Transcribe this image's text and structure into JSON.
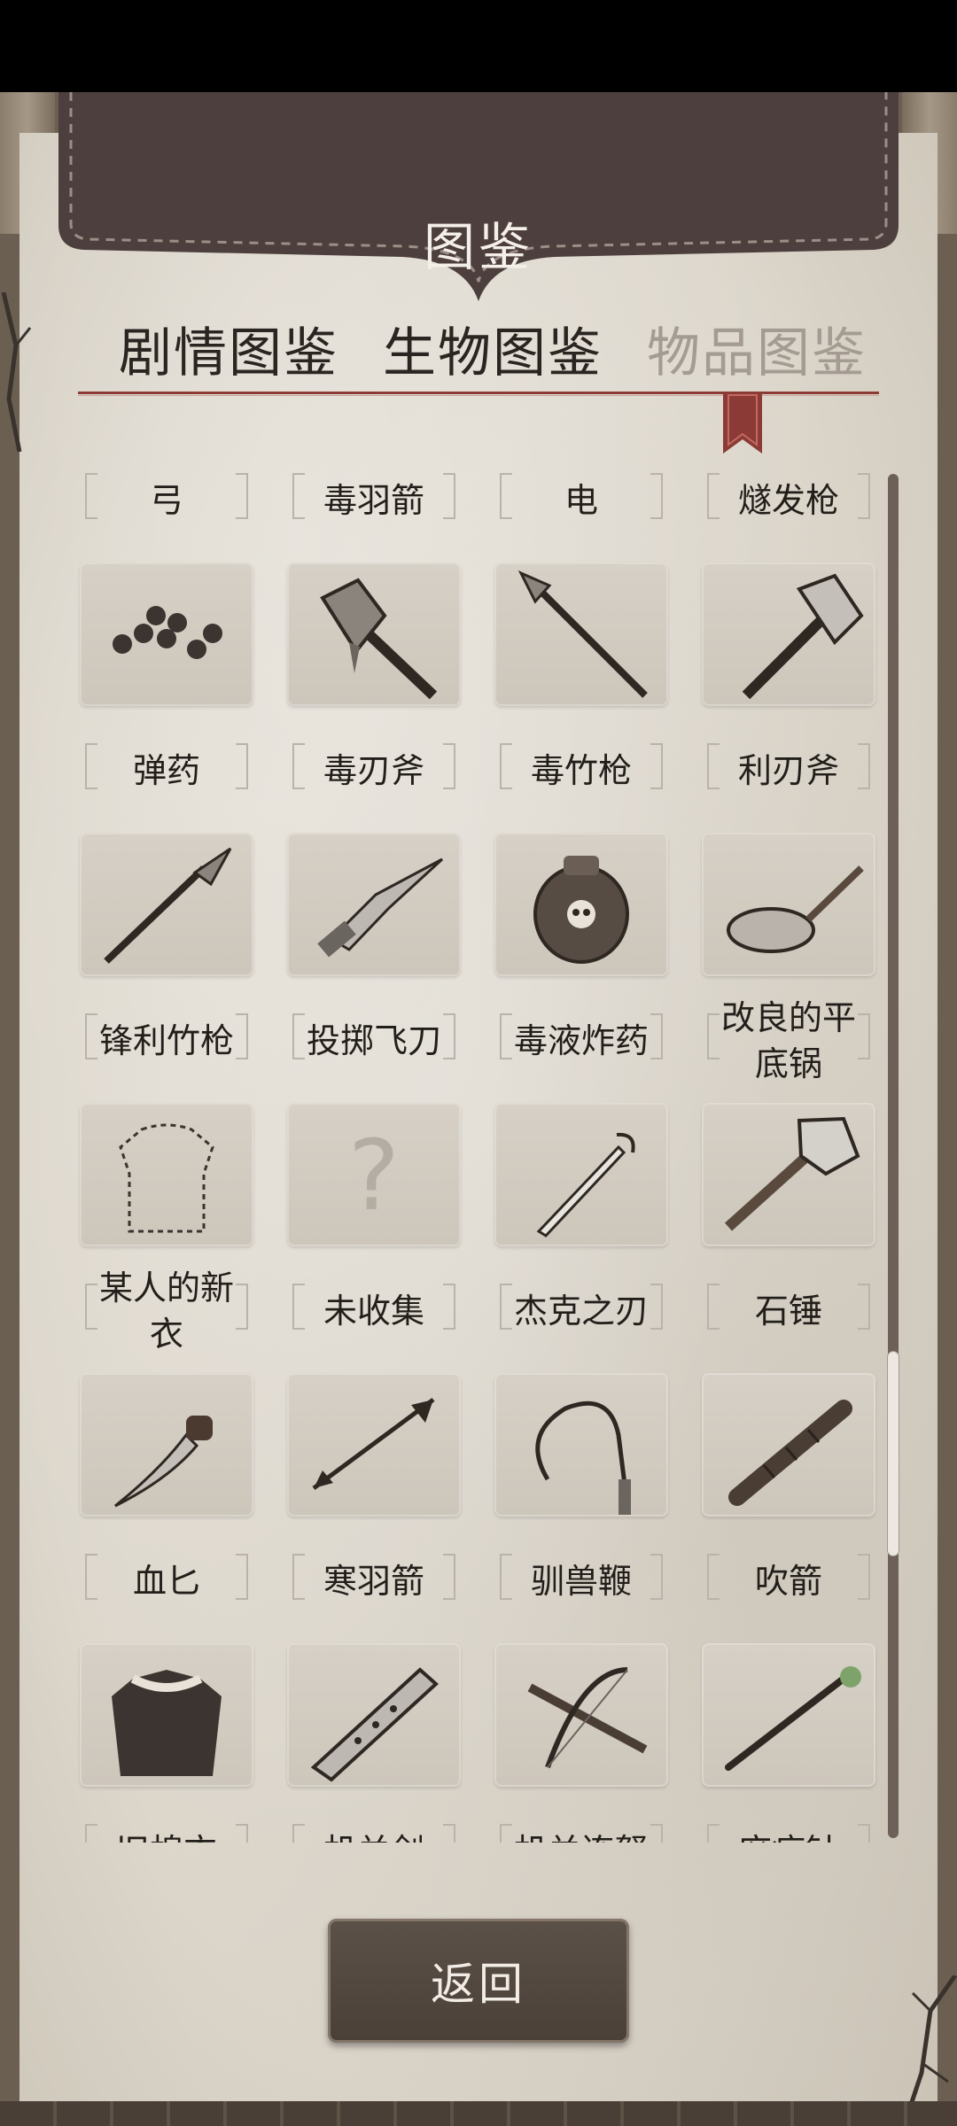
{
  "header": {
    "title": "图鉴"
  },
  "tabs": [
    {
      "label": "剧情图鉴",
      "active": false
    },
    {
      "label": "生物图鉴",
      "active": false
    },
    {
      "label": "物品图鉴",
      "active": true
    }
  ],
  "items": [
    {
      "label": "弓",
      "icon": "bow-icon"
    },
    {
      "label": "毒羽箭",
      "icon": "poison-arrow-icon"
    },
    {
      "label": "电",
      "icon": "lightning-icon"
    },
    {
      "label": "燧发枪",
      "icon": "musket-icon"
    },
    {
      "label": "弹药",
      "icon": "ammo-pellets-icon"
    },
    {
      "label": "毒刃斧",
      "icon": "poison-blade-axe-icon"
    },
    {
      "label": "毒竹枪",
      "icon": "poison-bamboo-spear-icon"
    },
    {
      "label": "利刃斧",
      "icon": "sharp-axe-icon"
    },
    {
      "label": "锋利竹枪",
      "icon": "sharp-bamboo-spear-icon"
    },
    {
      "label": "投掷飞刀",
      "icon": "throwing-knife-icon"
    },
    {
      "label": "毒液炸药",
      "icon": "venom-bomb-icon"
    },
    {
      "label": "改良的平底锅",
      "icon": "frying-pan-icon"
    },
    {
      "label": "某人的新衣",
      "icon": "dotted-garment-icon"
    },
    {
      "label": "未收集",
      "icon": "question-mark-icon"
    },
    {
      "label": "杰克之刃",
      "icon": "jack-blade-icon"
    },
    {
      "label": "石锤",
      "icon": "stone-hammer-icon"
    },
    {
      "label": "血匕",
      "icon": "blood-dagger-icon"
    },
    {
      "label": "寒羽箭",
      "icon": "frost-arrow-icon"
    },
    {
      "label": "驯兽鞭",
      "icon": "whip-icon"
    },
    {
      "label": "吹箭",
      "icon": "blowgun-icon"
    },
    {
      "label": "旧棉衣",
      "icon": "old-cotton-coat-icon"
    },
    {
      "label": "机关剑",
      "icon": "mechanism-sword-icon"
    },
    {
      "label": "机关连弩",
      "icon": "repeating-crossbow-icon"
    },
    {
      "label": "麻痹针",
      "icon": "paralysis-needle-icon"
    }
  ],
  "scroll": {
    "position": 0.72
  },
  "footer": {
    "back_label": "返回"
  },
  "colors": {
    "accent": "#8c3a35",
    "paper": "#e3ded5",
    "slot": "#d2ccc2",
    "banner": "#4d3f3d"
  }
}
